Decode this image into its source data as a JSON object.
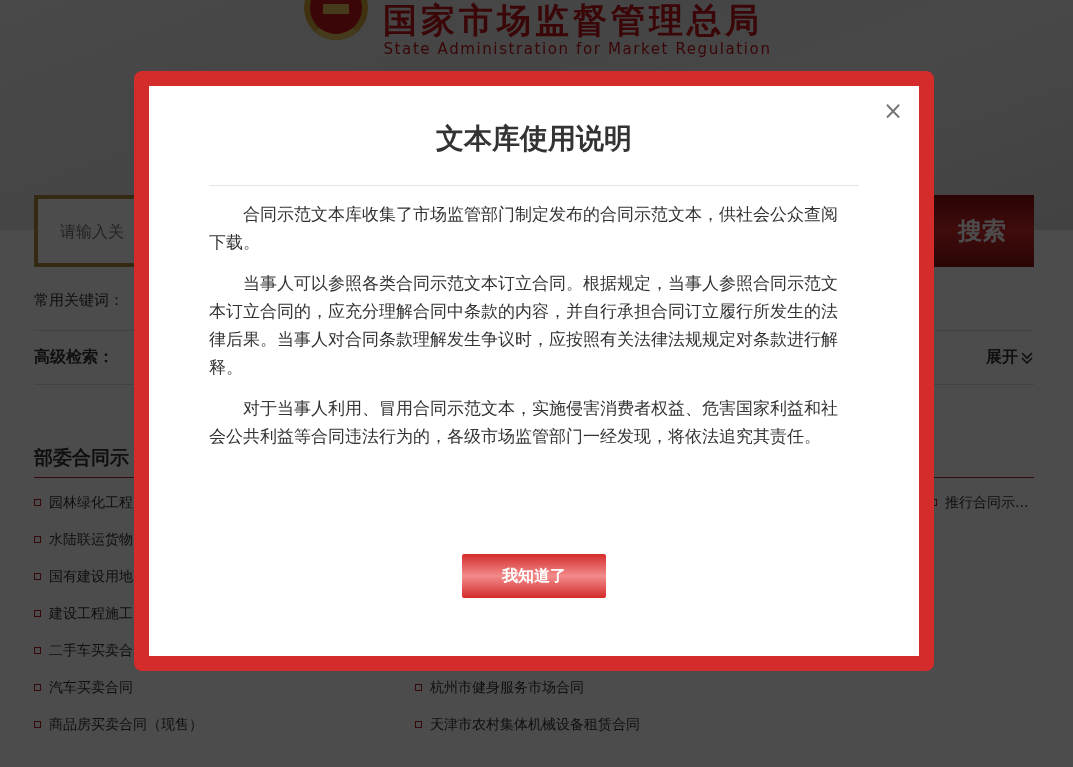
{
  "header": {
    "title": "国家市场监督管理总局",
    "subtitle": "State Administration for Market Regulation"
  },
  "search": {
    "placeholder": "请输入关",
    "button": "搜索"
  },
  "keywords": {
    "label": "常用关键词："
  },
  "advanced": {
    "label": "高级检索：",
    "toggle": "展开"
  },
  "section": {
    "title": "部委合同示",
    "rows": [
      {
        "left": "园林绿化工程",
        "right": "推行合同示..."
      },
      {
        "left": "水陆联运货物"
      },
      {
        "left": "国有建设用地"
      },
      {
        "left": "建设工程施工"
      },
      {
        "left": "二手车买卖合"
      },
      {
        "left": "汽车买卖合同",
        "middle": "杭州市健身服务市场合同"
      },
      {
        "left": "商品房买卖合同（现售）",
        "middle": "天津市农村集体机械设备租赁合同"
      }
    ]
  },
  "dialog": {
    "title": "文本库使用说明",
    "close": "×",
    "paragraphs": [
      "合同示范文本库收集了市场监管部门制定发布的合同示范文本，供社会公众查阅下载。",
      "当事人可以参照各类合同示范文本订立合同。根据规定，当事人参照合同示范文本订立合同的，应充分理解合同中条款的内容，并自行承担合同订立履行所发生的法律后果。当事人对合同条款理解发生争议时，应按照有关法律法规规定对条款进行解释。",
      "对于当事人利用、冒用合同示范文本，实施侵害消费者权益、危害国家利益和社会公共利益等合同违法行为的，各级市场监管部门一经发现，将依法追究其责任。"
    ],
    "button": "我知道了"
  }
}
